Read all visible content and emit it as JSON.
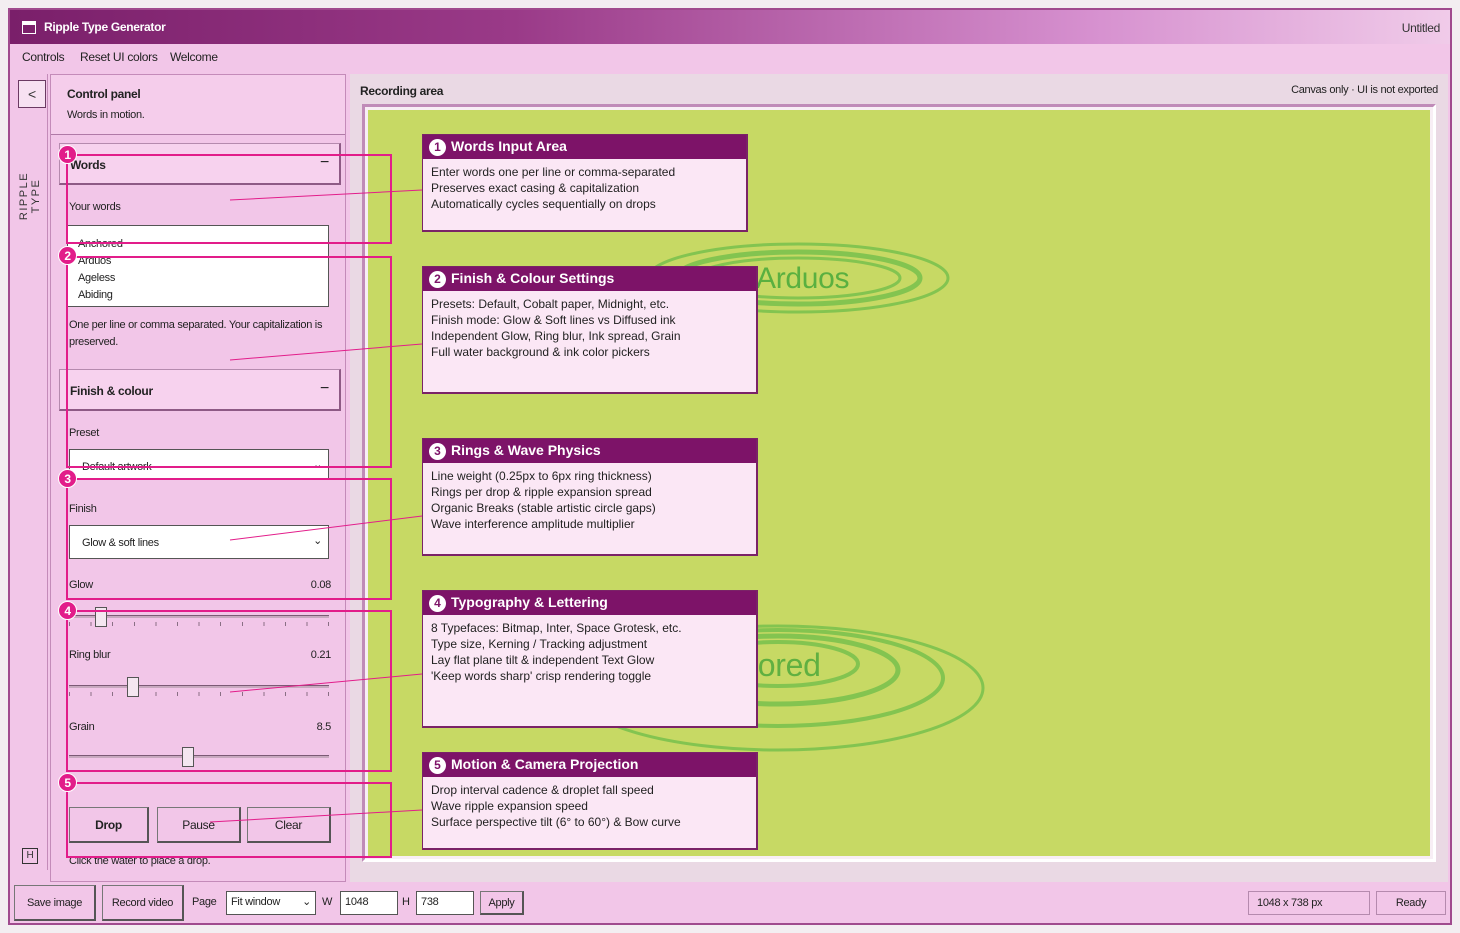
{
  "window": {
    "title": "Ripple Type Generator",
    "document": "Untitled"
  },
  "menu": [
    "Controls",
    "Reset UI colors",
    "Welcome"
  ],
  "sidebar": {
    "back_icon": "chevron-left-icon",
    "back_glyph": "<",
    "vertical_label": "RIPPLE TYPE",
    "h_label": "H"
  },
  "control_panel": {
    "title": "Control panel",
    "subtitle": "Words in motion.",
    "words": {
      "header": "Words",
      "collapse": "−",
      "label": "Your words",
      "lines": [
        "Anchored",
        "Arduos",
        "Ageless",
        "Abiding"
      ],
      "hint": "One per line or comma separated. Your capitalization is preserved."
    },
    "finish": {
      "header": "Finish & colour",
      "collapse": "−",
      "preset_label": "Preset",
      "preset_value": "Default artwork",
      "finish_label": "Finish",
      "finish_value": "Glow & soft lines",
      "glow_label": "Glow",
      "glow_value": "0.08",
      "glow_fraction": 0.08,
      "ringblur_label": "Ring blur",
      "ringblur_value": "0.21",
      "ringblur_fraction": 0.21,
      "grain_label": "Grain",
      "grain_value": "8.5",
      "grain_fraction": 0.43
    },
    "buttons": {
      "drop": "Drop",
      "pause": "Pause",
      "clear": "Clear"
    },
    "footer_hint": "Click the water to place a drop."
  },
  "recording": {
    "title": "Recording area",
    "note": "Canvas only · UI is not exported",
    "canvas_words": [
      "Arduos",
      "Anchored"
    ],
    "canvas_color": "#c7d964"
  },
  "callouts": [
    {
      "num": "1",
      "title": "Words Input Area",
      "items": [
        "Enter words one per line or comma-separated",
        "Preserves exact casing & capitalization",
        "Automatically cycles sequentially on drops"
      ]
    },
    {
      "num": "2",
      "title": "Finish & Colour Settings",
      "items": [
        "Presets: Default, Cobalt paper, Midnight, etc.",
        "Finish mode: Glow & Soft lines vs Diffused ink",
        "Independent Glow, Ring blur, Ink spread, Grain",
        "Full water background & ink color pickers"
      ]
    },
    {
      "num": "3",
      "title": "Rings & Wave Physics",
      "items": [
        "Line weight (0.25px to 6px ring thickness)",
        "Rings per drop & ripple expansion spread",
        "Organic Breaks (stable artistic circle gaps)",
        "Wave interference amplitude multiplier"
      ]
    },
    {
      "num": "4",
      "title": "Typography & Lettering",
      "items": [
        "8 Typefaces: Bitmap, Inter, Space Grotesk, etc.",
        "Type size, Kerning / Tracking adjustment",
        "Lay flat plane tilt & independent Text Glow",
        "'Keep words sharp' crisp rendering toggle"
      ]
    },
    {
      "num": "5",
      "title": "Motion & Camera Projection",
      "items": [
        "Drop interval cadence & droplet fall speed",
        "Wave ripple expansion speed",
        "Surface perspective tilt (6° to 60°) & Bow curve"
      ]
    }
  ],
  "statusbar": {
    "save": "Save image",
    "record": "Record video",
    "page_label": "Page",
    "page_value": "Fit window",
    "w_label": "W",
    "w_value": "1048",
    "h_label": "H",
    "h_value": "738",
    "apply": "Apply",
    "size": "1048 x 738 px",
    "status": "Ready"
  },
  "colors": {
    "accent": "#7d1368",
    "highlight": "#e21d8a",
    "panel": "#f2c6e8"
  }
}
